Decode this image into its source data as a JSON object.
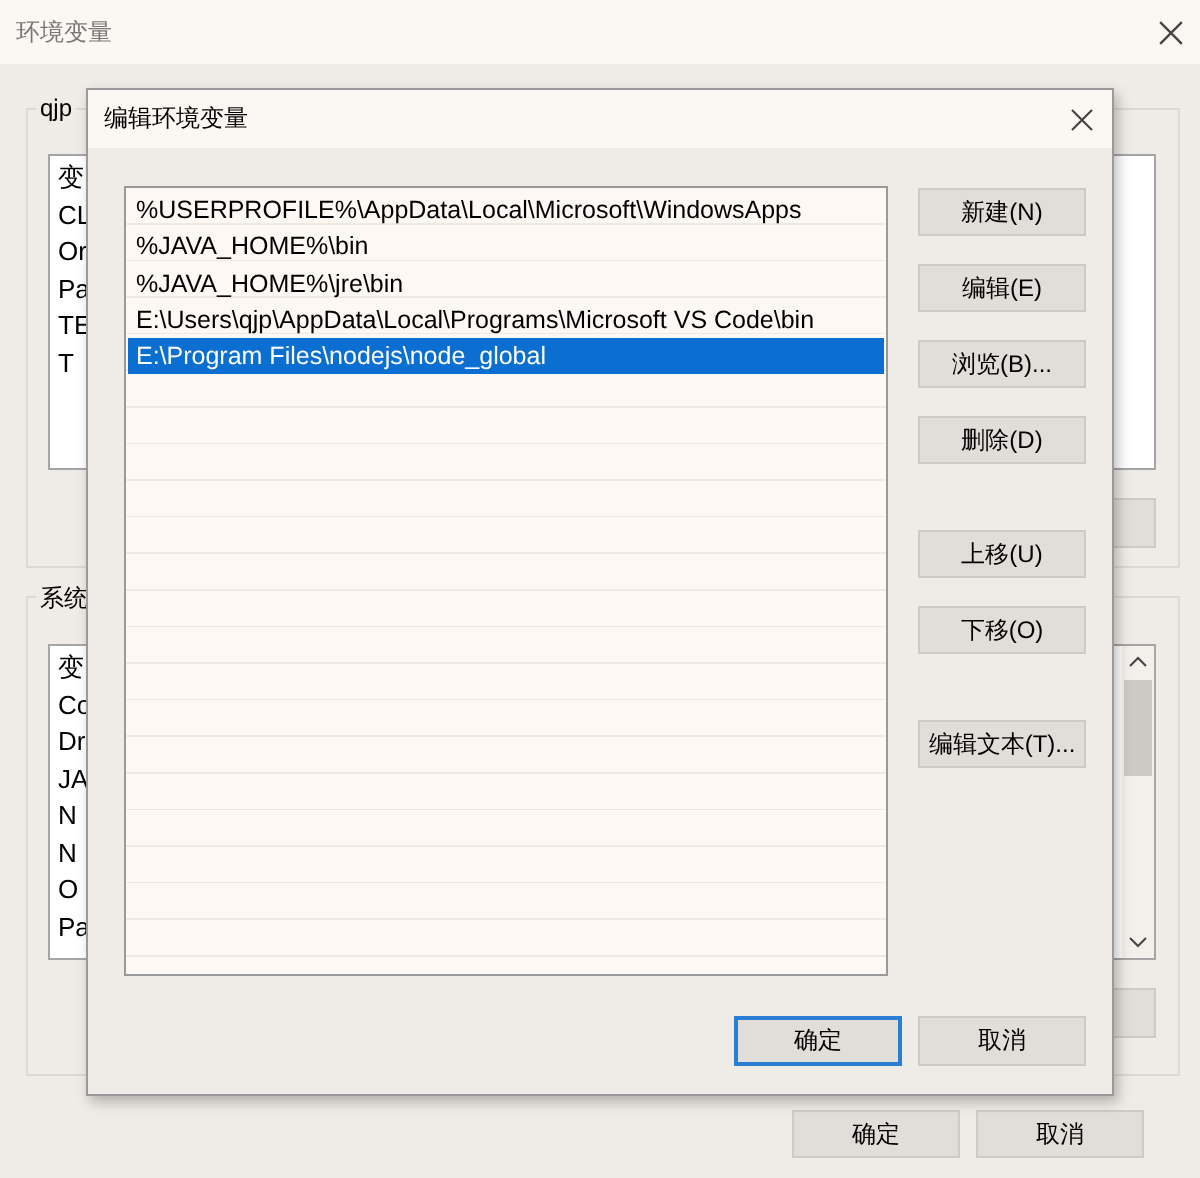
{
  "background_window": {
    "title": "环境变量",
    "user_group": {
      "label": "qjp",
      "header": "变",
      "rows": [
        "CL",
        "Or",
        "Pa",
        "TE",
        "T"
      ]
    },
    "system_group": {
      "label": "系统",
      "header": "变",
      "rows": [
        "Co",
        "Dr",
        "JA",
        "N",
        "N",
        "O",
        "Pa"
      ]
    },
    "buttons": [
      "确定",
      "取消"
    ]
  },
  "dialog": {
    "title": "编辑环境变量",
    "entries": [
      {
        "text": "%USERPROFILE%\\AppData\\Local\\Microsoft\\WindowsApps",
        "selected": false
      },
      {
        "text": "%JAVA_HOME%\\bin",
        "selected": false
      },
      {
        "text": "%JAVA_HOME%\\jre\\bin",
        "selected": false
      },
      {
        "text": "E:\\Users\\qjp\\AppData\\Local\\Programs\\Microsoft VS Code\\bin",
        "selected": false
      },
      {
        "text": "E:\\Program Files\\nodejs\\node_global",
        "selected": true
      }
    ],
    "side_button_groups": [
      [
        "新建(N)",
        "编辑(E)",
        "浏览(B)...",
        "删除(D)"
      ],
      [
        "上移(U)",
        "下移(O)"
      ],
      [
        "编辑文本(T)..."
      ]
    ],
    "footer_buttons": [
      {
        "label": "确定",
        "default": true
      },
      {
        "label": "取消",
        "default": false
      }
    ]
  }
}
